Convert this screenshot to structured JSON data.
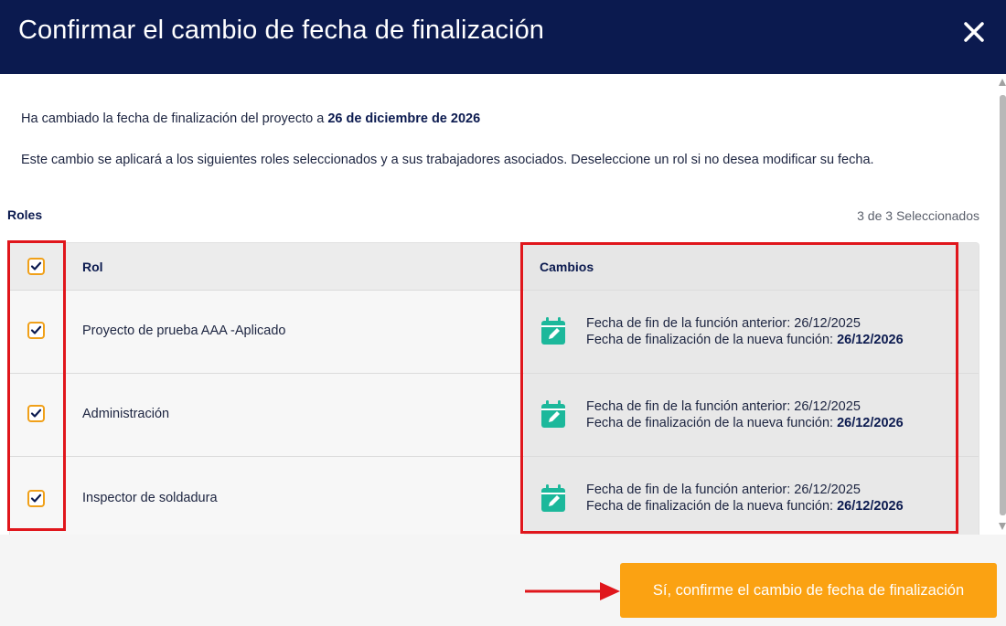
{
  "dialog": {
    "title": "Confirmar el cambio de fecha de finalización",
    "close_icon": "close-icon"
  },
  "intro": {
    "line1_prefix": "Ha cambiado la fecha de finalización del proyecto a ",
    "line1_date": "26 de diciembre de 2026",
    "line2": "Este cambio se aplicará a los siguientes roles seleccionados y a sus trabajadores asociados. Deseleccione un rol si no desea modificar su fecha."
  },
  "roles": {
    "title": "Roles",
    "selected_count": "3 de 3 Seleccionados",
    "columns": {
      "rol": "Rol",
      "cambios": "Cambios"
    },
    "rows": [
      {
        "name": "Proyecto de prueba AAA -Aplicado",
        "checked": true,
        "old_label": "Fecha de fin de la función anterior: 26/12/2025",
        "new_label": "Fecha de finalización de la nueva función: ",
        "new_date": "26/12/2026"
      },
      {
        "name": "Administración",
        "checked": true,
        "old_label": "Fecha de fin de la función anterior: 26/12/2025",
        "new_label": "Fecha de finalización de la nueva función: ",
        "new_date": "26/12/2026"
      },
      {
        "name": "Inspector de soldadura",
        "checked": true,
        "old_label": "Fecha de fin de la función anterior: 26/12/2025",
        "new_label": "Fecha de finalización de la nueva función: ",
        "new_date": "26/12/2026"
      }
    ]
  },
  "footer": {
    "confirm_label": "Sí, confirme el cambio de fecha de finalización"
  },
  "colors": {
    "header_bg": "#0b1a4f",
    "accent_orange": "#fba212",
    "checkbox_border": "#f0a019",
    "calendar_teal": "#1cb89b",
    "annotation_red": "#e0161c"
  },
  "icons": {
    "checkbox": "checkmark-icon",
    "calendar": "calendar-edit-icon",
    "arrow": "arrow-right-icon"
  }
}
